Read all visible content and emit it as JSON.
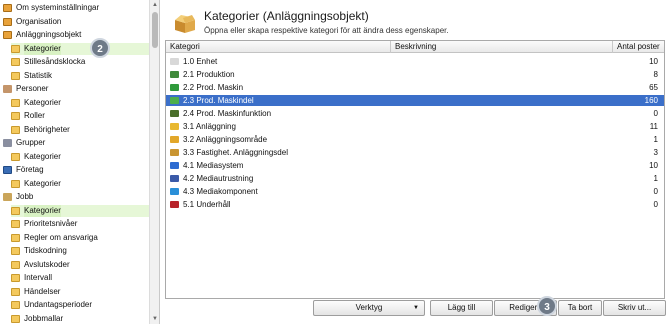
{
  "tree": {
    "items": [
      {
        "label": "Om systeminställningar",
        "icon": "info-icon",
        "kind": "root",
        "depth": 0
      },
      {
        "label": "Organisation",
        "icon": "organisation-icon",
        "kind": "root",
        "depth": 0
      },
      {
        "label": "Anläggningsobjekt",
        "icon": "asset-icon",
        "kind": "root",
        "depth": 0
      },
      {
        "label": "Kategorier",
        "icon": "folder-icon",
        "kind": "folder",
        "depth": 1,
        "selected": true
      },
      {
        "label": "Stillesåndsklocka",
        "icon": "folder-icon",
        "kind": "folder",
        "depth": 1
      },
      {
        "label": "Statistik",
        "icon": "folder-icon",
        "kind": "folder",
        "depth": 1
      },
      {
        "label": "Personer",
        "icon": "person-icon",
        "kind": "person",
        "depth": 0
      },
      {
        "label": "Kategorier",
        "icon": "folder-icon",
        "kind": "folder",
        "depth": 1
      },
      {
        "label": "Roller",
        "icon": "folder-icon",
        "kind": "folder",
        "depth": 1
      },
      {
        "label": "Behörigheter",
        "icon": "folder-icon",
        "kind": "folder",
        "depth": 1
      },
      {
        "label": "Grupper",
        "icon": "group-icon",
        "kind": "group",
        "depth": 0
      },
      {
        "label": "Kategorier",
        "icon": "folder-icon",
        "kind": "folder",
        "depth": 1
      },
      {
        "label": "Företag",
        "icon": "company-icon",
        "kind": "company",
        "depth": 0
      },
      {
        "label": "Kategorier",
        "icon": "folder-icon",
        "kind": "folder",
        "depth": 1
      },
      {
        "label": "Jobb",
        "icon": "job-icon",
        "kind": "job",
        "depth": 0
      },
      {
        "label": "Kategorier",
        "icon": "folder-icon",
        "kind": "folder",
        "depth": 1,
        "highlight": true
      },
      {
        "label": "Prioritetsnivåer",
        "icon": "folder-icon",
        "kind": "folder",
        "depth": 1
      },
      {
        "label": "Regler om ansvariga",
        "icon": "folder-icon",
        "kind": "folder",
        "depth": 1
      },
      {
        "label": "Tidskodning",
        "icon": "folder-icon",
        "kind": "folder",
        "depth": 1
      },
      {
        "label": "Avslutskoder",
        "icon": "folder-icon",
        "kind": "folder",
        "depth": 1
      },
      {
        "label": "Intervall",
        "icon": "folder-icon",
        "kind": "folder",
        "depth": 1
      },
      {
        "label": "Händelser",
        "icon": "folder-icon",
        "kind": "folder",
        "depth": 1
      },
      {
        "label": "Undantagsperioder",
        "icon": "folder-icon",
        "kind": "folder",
        "depth": 1
      },
      {
        "label": "Jobbmallar",
        "icon": "folder-icon",
        "kind": "folder",
        "depth": 1
      }
    ]
  },
  "badges": {
    "two": "2",
    "three": "3"
  },
  "header": {
    "title": "Kategorier (Anläggningsobjekt)",
    "subtitle": "Öppna eller skapa respektive kategori för att ändra dess egenskaper."
  },
  "grid": {
    "columns": {
      "category": "Kategori",
      "description": "Beskrivning",
      "count": "Antal poster"
    },
    "rows": [
      {
        "name": "1.0 Enhet",
        "count": "10",
        "icon": "blank-icon",
        "color": "#d8d8d8"
      },
      {
        "name": "2.1 Produktion",
        "count": "8",
        "icon": "factory-icon",
        "color": "#3f8a3a"
      },
      {
        "name": "2.2 Prod. Maskin",
        "count": "65",
        "icon": "machine-icon",
        "color": "#2f9a3b"
      },
      {
        "name": "2.3 Prod. Maskindel",
        "count": "160",
        "icon": "machine-part-icon",
        "color": "#4cae4c",
        "selected": true
      },
      {
        "name": "2.4 Prod. Maskinfunktion",
        "count": "0",
        "icon": "arrows-icon",
        "color": "#4a6f2a"
      },
      {
        "name": "3.1 Anläggning",
        "count": "11",
        "icon": "building-icon",
        "color": "#e8b830"
      },
      {
        "name": "3.2 Anläggningsområde",
        "count": "1",
        "icon": "area-icon",
        "color": "#e2a72a"
      },
      {
        "name": "3.3 Fastighet. Anläggningsdel",
        "count": "3",
        "icon": "property-icon",
        "color": "#c99532"
      },
      {
        "name": "4.1 Mediasystem",
        "count": "10",
        "icon": "media-system-icon",
        "color": "#2d6bd1"
      },
      {
        "name": "4.2 Mediautrustning",
        "count": "1",
        "icon": "media-equipment-icon",
        "color": "#3b5aa8"
      },
      {
        "name": "4.3 Mediakomponent",
        "count": "0",
        "icon": "play-icon",
        "color": "#2a8fd8"
      },
      {
        "name": "5.1 Underhåll",
        "count": "0",
        "icon": "maintenance-icon",
        "color": "#b8232a"
      }
    ]
  },
  "buttons": {
    "tools": "Verktyg",
    "add": "Lägg till",
    "edit": "Redigera",
    "delete": "Ta bort",
    "print": "Skriv ut..."
  },
  "colors": {
    "selection": "#3b6fc9",
    "tree_highlight": "#e6f7d7"
  }
}
